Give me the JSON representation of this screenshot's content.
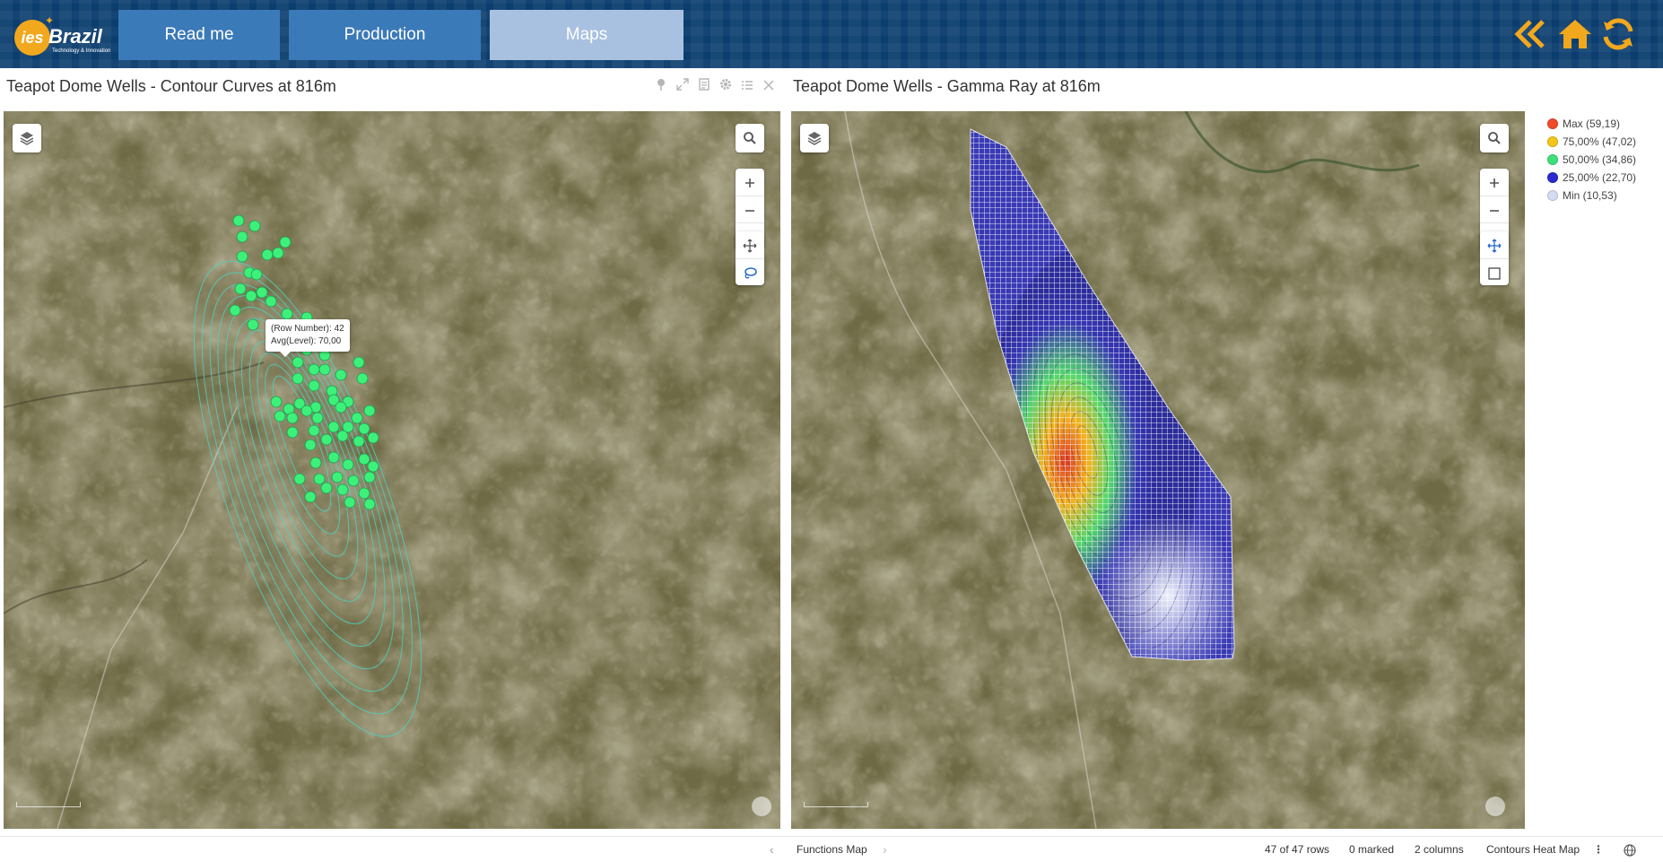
{
  "header": {
    "logo": {
      "mark": "ies",
      "brand": "Brazil",
      "tagline": "Technology & Innovation"
    },
    "tabs": [
      {
        "label": "Read me",
        "active": false
      },
      {
        "label": "Production",
        "active": false
      },
      {
        "label": "Maps",
        "active": true
      }
    ],
    "nav_icons": [
      "rewind-icon",
      "home-icon",
      "refresh-icon"
    ],
    "colors": {
      "bar": "#0b3d6e",
      "tab": "#3b7ab8",
      "tab_active": "#a9c1e0",
      "accent": "#f2a81d"
    }
  },
  "left_panel": {
    "title": "Teapot Dome Wells - Contour Curves at 816m",
    "tools": [
      "pin-icon",
      "expand-icon",
      "notes-icon",
      "settings-icon",
      "list-icon",
      "close-icon"
    ],
    "tooltip": {
      "line1": "(Row Number): 42",
      "line2": "Avg(Level): 70,00"
    },
    "marker_color": "#3df07a"
  },
  "right_panel": {
    "title": "Teapot Dome Wells - Gamma Ray at 816m"
  },
  "legend": {
    "items": [
      {
        "label": "Max (59,19)",
        "color": "#f04a2a"
      },
      {
        "label": "75,00% (47,02)",
        "color": "#f5c518"
      },
      {
        "label": "50,00% (34,86)",
        "color": "#3de07a"
      },
      {
        "label": "25,00% (22,70)",
        "color": "#2a2ad0"
      },
      {
        "label": "Min (10,53)",
        "color": "#d4dcf4"
      }
    ]
  },
  "statusbar": {
    "page_name": "Functions Map",
    "rows": "47 of 47 rows",
    "marked": "0 marked",
    "columns": "2 columns",
    "visualization": "Contours Heat Map"
  }
}
